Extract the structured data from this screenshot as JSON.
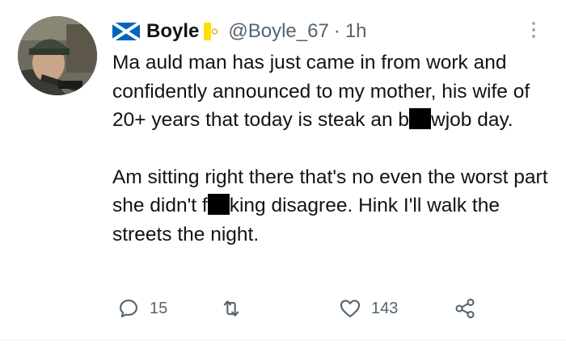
{
  "tweet": {
    "display_name": "Boyle",
    "handle": "@Boyle_67",
    "separator": "·",
    "time": "1h",
    "avatar_icon": "user-avatar-photo",
    "flag_left_icon": "scotland-flag-icon",
    "flag_right_icon": "vatican-flag-icon",
    "paragraph1_a": "Ma auld man has just came in from work and confidently announced to my mother, his wife of 20+ years that today is steak an b",
    "paragraph1_b": "wjob day.",
    "paragraph2_a": "Am sitting right there that's no even the worst part she didn't f",
    "paragraph2_b": "king disagree. Hink I'll walk the streets the night."
  },
  "actions": {
    "reply_count": "15",
    "retweet_count": "",
    "like_count": "143",
    "icons": [
      "reply-icon",
      "retweet-icon",
      "like-icon",
      "share-icon"
    ]
  },
  "colors": {
    "text": "#0f1419",
    "secondary": "#536471",
    "redaction": "#000000"
  }
}
